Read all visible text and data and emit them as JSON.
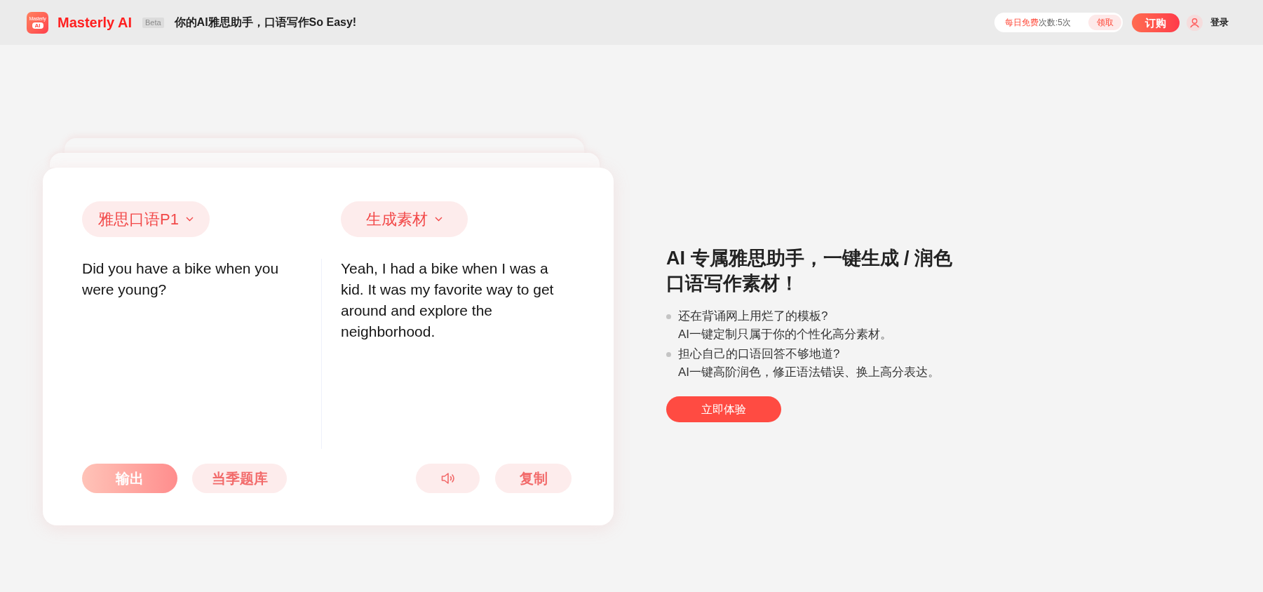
{
  "header": {
    "logo": {
      "line1": "Masterly",
      "line2": "AI"
    },
    "brand": "Masterly AI",
    "badge": "Beta",
    "tagline": "你的AI雅思助手，口语写作So Easy!",
    "quota": {
      "highlight": "每日免费",
      "rest": "次数:5次",
      "action": "领取"
    },
    "subscribe": "订购",
    "login": "登录"
  },
  "card": {
    "selectors": [
      {
        "label": "雅思口语P1"
      },
      {
        "label": "生成素材"
      }
    ],
    "question": "Did you have a bike when you were young?",
    "answer": "Yeah, I had a bike when I was a kid. It was my favorite way to get around and explore the neighborhood.",
    "actions": [
      {
        "kind": "primary",
        "label": "输出"
      },
      {
        "kind": "secondary",
        "label": "当季题库"
      }
    ],
    "tools": [
      {
        "kind": "speaker"
      },
      {
        "kind": "text",
        "label": "复制"
      }
    ]
  },
  "promo": {
    "heading": "AI 专属雅思助手，一键生成 / 润色口语写作素材！",
    "points": [
      {
        "question": "还在背诵网上用烂了的模板?",
        "answer": "AI一键定制只属于你的个性化高分素材。"
      },
      {
        "question": "担心自己的口语回答不够地道?",
        "answer": "AI一键高阶润色，修正语法错误、换上高分表达。"
      }
    ],
    "cta": "立即体验"
  }
}
